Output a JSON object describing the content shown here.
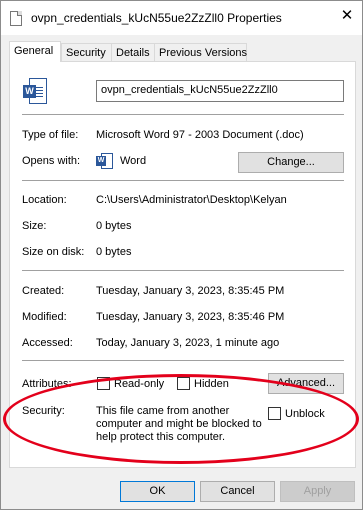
{
  "window": {
    "title": "ovpn_credentials_kUcN55ue2ZzZll0 Properties",
    "close_glyph": "✕"
  },
  "tabs": [
    {
      "label": "General",
      "active": true
    },
    {
      "label": "Security"
    },
    {
      "label": "Details"
    },
    {
      "label": "Previous Versions"
    }
  ],
  "file": {
    "name": "ovpn_credentials_kUcN55ue2ZzZll0",
    "icon": "word-document-icon"
  },
  "properties": {
    "type_label": "Type of file:",
    "type_value": "Microsoft Word 97 - 2003 Document (.doc)",
    "opens_label": "Opens with:",
    "opens_value": "Word",
    "change_button": "Change...",
    "location_label": "Location:",
    "location_value": "C:\\Users\\Administrator\\Desktop\\Kelyan",
    "size_label": "Size:",
    "size_value": "0 bytes",
    "size_disk_label": "Size on disk:",
    "size_disk_value": "0 bytes",
    "created_label": "Created:",
    "created_value": "Tuesday, January 3, 2023, 8:35:45 PM",
    "modified_label": "Modified:",
    "modified_value": "Tuesday, January 3, 2023, 8:35:46 PM",
    "accessed_label": "Accessed:",
    "accessed_value": "Today, January 3, 2023, 1 minute ago",
    "attributes_label": "Attributes:",
    "readonly_label": "Read-only",
    "hidden_label": "Hidden",
    "advanced_button": "Advanced...",
    "security_label": "Security:",
    "security_text_1": "This file came from another",
    "security_text_2": "computer and might be blocked to",
    "security_text_3": "help protect this computer.",
    "unblock_label": "Unblock"
  },
  "footer": {
    "ok": "OK",
    "cancel": "Cancel",
    "apply": "Apply"
  },
  "colors": {
    "highlight": "#e3001b",
    "word_blue": "#2b579a",
    "focus_blue": "#0078d7"
  }
}
